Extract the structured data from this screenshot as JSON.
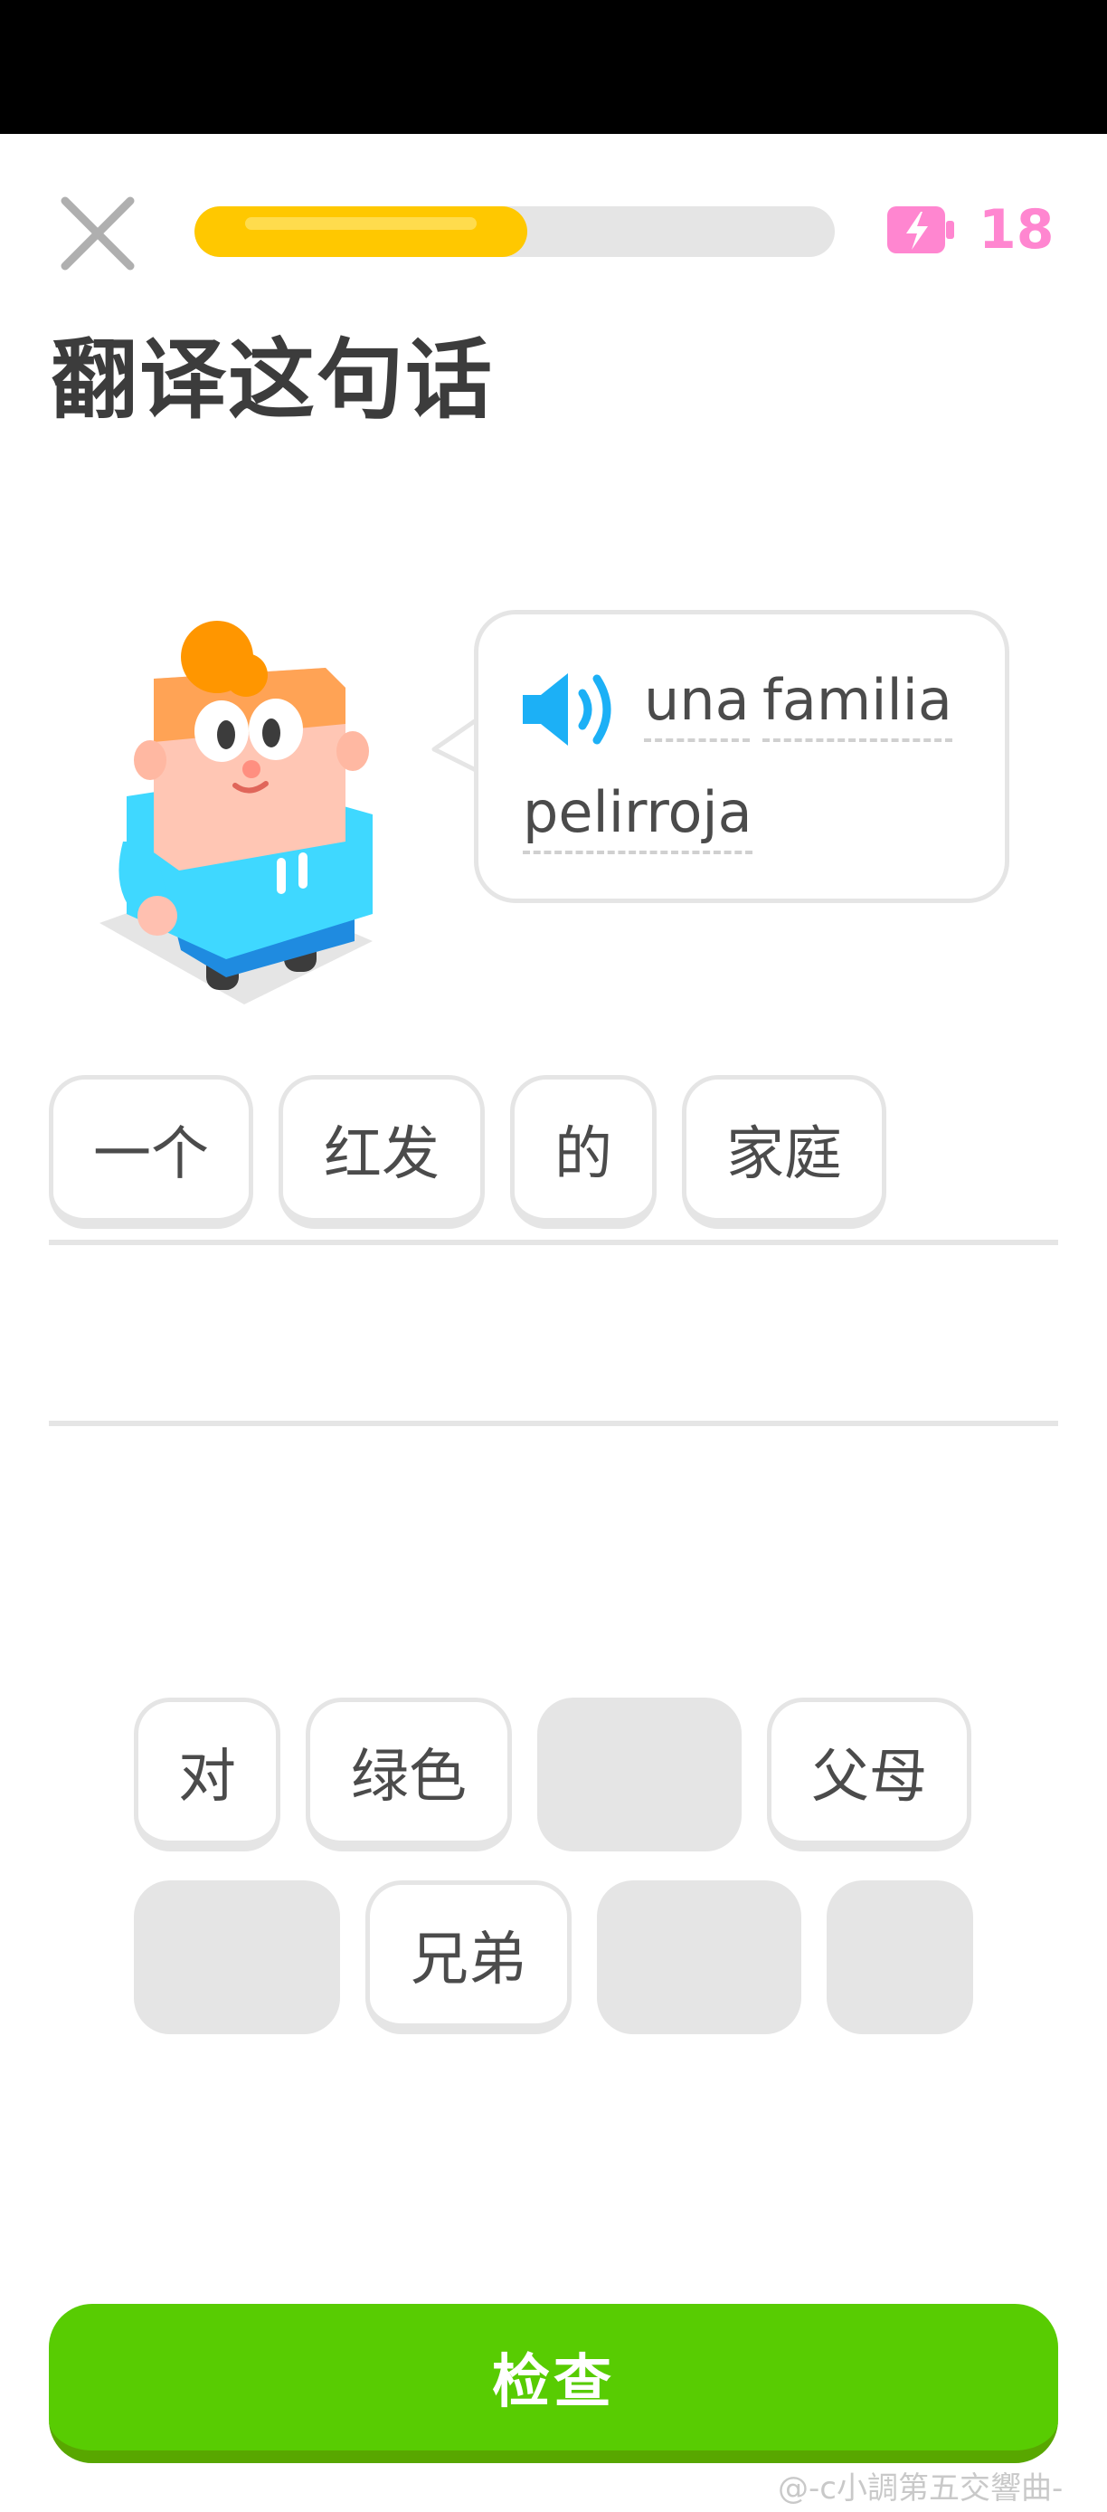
{
  "header": {
    "progress_fraction": 0.52,
    "energy_count": "18",
    "colors": {
      "progress": "#ffc800",
      "energy": "#ff86d0"
    }
  },
  "title": "翻译这句话",
  "prompt": {
    "words": [
      "una",
      "familia",
      "pelirroja"
    ],
    "speaker_icon": "speaker-icon"
  },
  "answer_tiles": [
    "一个",
    "红发",
    "的",
    "家庭"
  ],
  "word_bank": {
    "row1": [
      "对",
      "绿色",
      "",
      "父母"
    ],
    "row2": [
      "",
      "兄弟",
      "",
      ""
    ]
  },
  "check_button": {
    "label": "检查",
    "color": "#58cc02"
  },
  "watermark": "@-c小調第五交響曲-"
}
